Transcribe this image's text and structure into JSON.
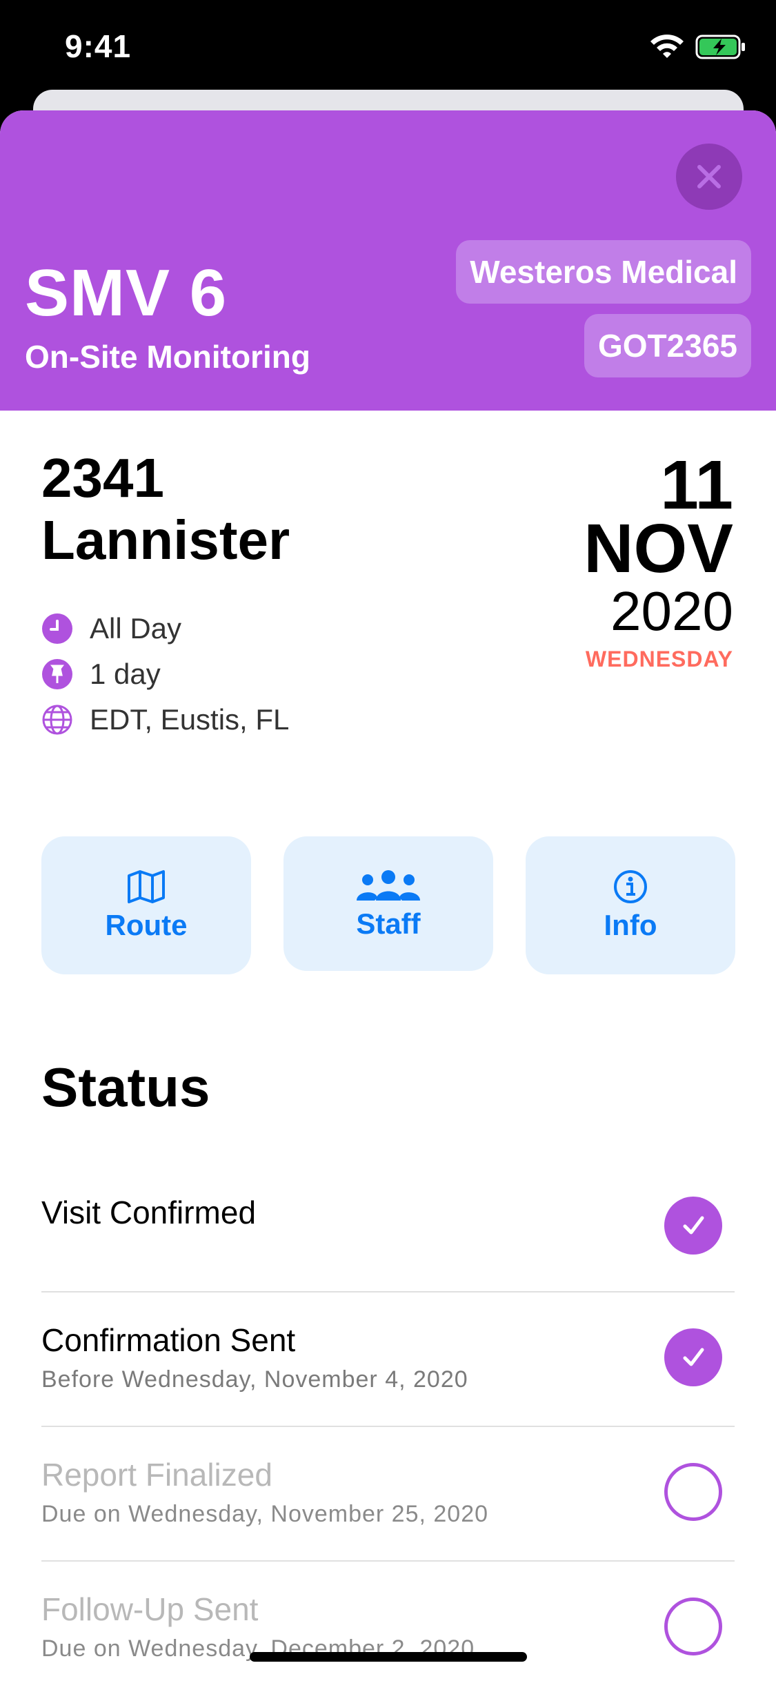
{
  "status_bar": {
    "time": "9:41"
  },
  "header": {
    "title": "SMV 6",
    "subtitle": "On-Site Monitoring",
    "organization": "Westeros Medical",
    "code": "GOT2365",
    "accent_color": "#af52de"
  },
  "visit": {
    "id": "2341",
    "name": "Lannister",
    "details": [
      {
        "icon": "clock-icon",
        "text": "All Day"
      },
      {
        "icon": "pin-icon",
        "text": " 1 day"
      },
      {
        "icon": "globe-icon",
        "text": "EDT, Eustis, FL"
      }
    ],
    "date": {
      "day": "11",
      "month": "NOV",
      "year": "2020",
      "weekday": "WEDNESDAY"
    }
  },
  "actions": [
    {
      "label": "Route",
      "icon": "map-icon"
    },
    {
      "label": "Staff",
      "icon": "people-icon"
    },
    {
      "label": "Info",
      "icon": "info-icon"
    }
  ],
  "status": {
    "title": "Status",
    "items": [
      {
        "name": "Visit Confirmed",
        "sub": "",
        "done": true
      },
      {
        "name": "Confirmation Sent",
        "sub": "Before Wednesday, November 4, 2020",
        "done": true
      },
      {
        "name": "Report Finalized",
        "sub": "Due on Wednesday, November 25, 2020",
        "done": false
      },
      {
        "name": "Follow-Up Sent",
        "sub": "Due on Wednesday, December 2, 2020",
        "done": false
      }
    ]
  }
}
